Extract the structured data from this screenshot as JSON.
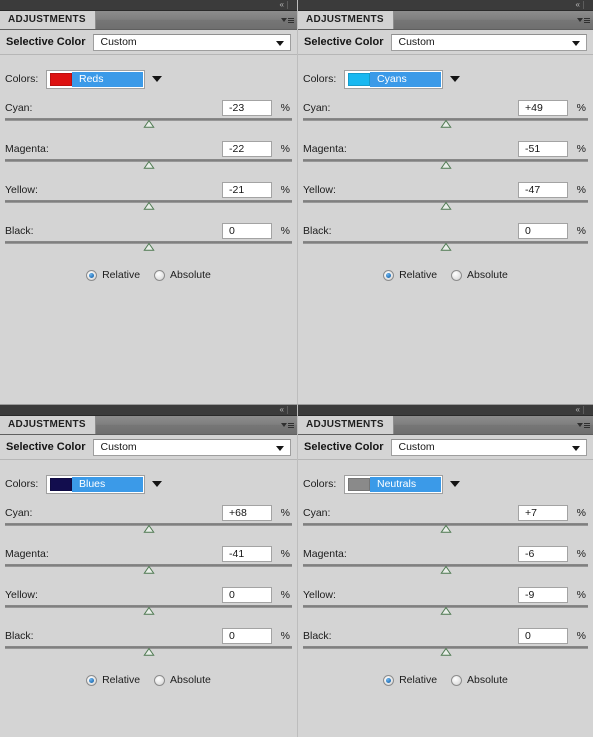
{
  "app": {
    "panel_tab_label": "ADJUSTMENTS",
    "header_title": "Selective Color",
    "preset_value": "Custom",
    "colors_label": "Colors:",
    "percent_symbol": "%",
    "collapse_icon": "«",
    "panel_menu_icon": "panel-menu-icon",
    "radio_relative_label": "Relative",
    "radio_absolute_label": "Absolute",
    "accent_selection_color": "#3b9ae8",
    "panel_background_color": "#d4d4d4",
    "tabbar_color": "#7e7e7e",
    "dockstrip_color": "#3b3b3b"
  },
  "slider_labels": {
    "cyan": "Cyan:",
    "magenta": "Magenta:",
    "yellow": "Yellow:",
    "black": "Black:"
  },
  "panels": [
    {
      "id": "top-left",
      "color_target": "Reds",
      "swatch_color": "#dd1111",
      "method": "Relative",
      "sliders": [
        {
          "name": "Cyan:",
          "value": "-23",
          "percent": 50
        },
        {
          "name": "Magenta:",
          "value": "-22",
          "percent": 50
        },
        {
          "name": "Yellow:",
          "value": "-21",
          "percent": 50
        },
        {
          "name": "Black:",
          "value": "0",
          "percent": 50
        }
      ]
    },
    {
      "id": "top-right",
      "color_target": "Cyans",
      "swatch_color": "#18b8f0",
      "method": "Relative",
      "sliders": [
        {
          "name": "Cyan:",
          "value": "+49",
          "percent": 50
        },
        {
          "name": "Magenta:",
          "value": "-51",
          "percent": 50
        },
        {
          "name": "Yellow:",
          "value": "-47",
          "percent": 50
        },
        {
          "name": "Black:",
          "value": "0",
          "percent": 50
        }
      ]
    },
    {
      "id": "bottom-left",
      "color_target": "Blues",
      "swatch_color": "#120d4e",
      "method": "Relative",
      "sliders": [
        {
          "name": "Cyan:",
          "value": "+68",
          "percent": 50
        },
        {
          "name": "Magenta:",
          "value": "-41",
          "percent": 50
        },
        {
          "name": "Yellow:",
          "value": "0",
          "percent": 50
        },
        {
          "name": "Black:",
          "value": "0",
          "percent": 50
        }
      ]
    },
    {
      "id": "bottom-right",
      "color_target": "Neutrals",
      "swatch_color": "#8a8a8a",
      "method": "Relative",
      "sliders": [
        {
          "name": "Cyan:",
          "value": "+7",
          "percent": 50
        },
        {
          "name": "Magenta:",
          "value": "-6",
          "percent": 50
        },
        {
          "name": "Yellow:",
          "value": "-9",
          "percent": 50
        },
        {
          "name": "Black:",
          "value": "0",
          "percent": 50
        }
      ]
    }
  ]
}
